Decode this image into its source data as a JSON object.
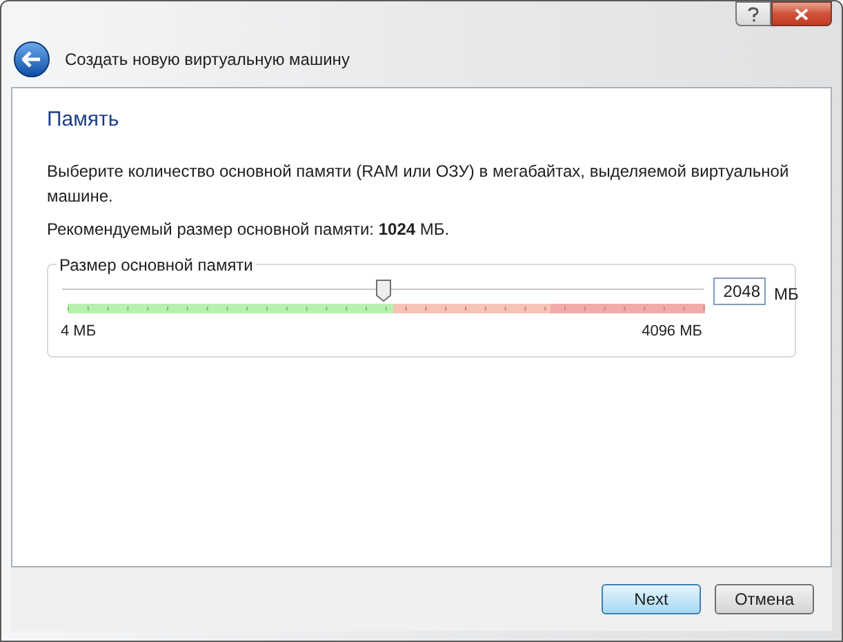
{
  "window": {
    "title": "Создать новую виртуальную машину"
  },
  "page": {
    "heading": "Память",
    "description": "Выберите количество основной памяти (RAM или ОЗУ) в мегабайтах, выделяемой виртуальной машине.",
    "recommendation": "Рекомендуемый размер основной памяти: **1024** МБ."
  },
  "memory_group": {
    "title": "Размер основной памяти",
    "level": 0.5,
    "value": "2048",
    "unit": "МБ",
    "min_label": "4 МБ",
    "max_label": "4096 МБ"
  },
  "buttons": [
    {
      "label": "Next",
      "kind": "default"
    },
    {
      "label": "Отмена",
      "kind": "normal"
    }
  ]
}
